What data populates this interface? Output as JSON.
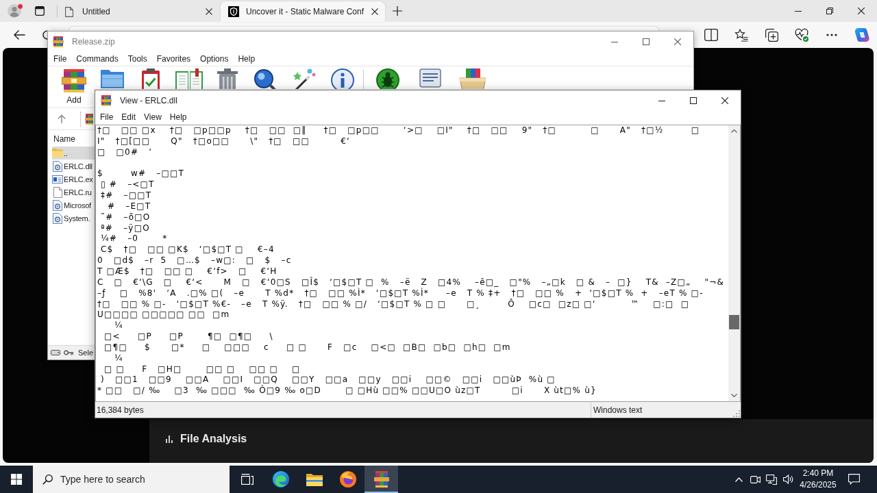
{
  "browser": {
    "tabs": [
      {
        "title": "Untitled",
        "kind": "document",
        "selected": false
      },
      {
        "title": "Uncover it - Static Malware Conf",
        "kind": "site",
        "selected": true
      }
    ]
  },
  "page": {
    "section_title": "File Analysis"
  },
  "archive_window": {
    "title": "Release.zip",
    "active": false,
    "menu": [
      "File",
      "Commands",
      "Tools",
      "Favorites",
      "Options",
      "Help"
    ],
    "toolbar_groups": [
      [
        {
          "kind": "add",
          "label": "Add"
        },
        {
          "kind": "extract"
        },
        {
          "kind": "test"
        },
        {
          "kind": "view"
        },
        {
          "kind": "delete"
        },
        {
          "kind": "find"
        },
        {
          "kind": "wizard"
        },
        {
          "kind": "info"
        }
      ],
      [
        {
          "kind": "virus_scan"
        },
        {
          "kind": "comment"
        },
        {
          "kind": "sfx"
        }
      ]
    ],
    "column": "Name",
    "files": [
      {
        "name": "..",
        "kind": "folder",
        "selected": true
      },
      {
        "name": "ERLC.dll",
        "kind": "library",
        "selected": false
      },
      {
        "name": "ERLC.ex",
        "kind": "program",
        "selected": false
      },
      {
        "name": "ERLC.ru",
        "kind": "file",
        "selected": false
      },
      {
        "name": "Microsof",
        "kind": "library",
        "selected": false
      },
      {
        "name": "System.",
        "kind": "library",
        "selected": false
      }
    ],
    "status": "Sele"
  },
  "viewer_window": {
    "title": "View - ERLC.dll",
    "active": true,
    "menu": [
      "File",
      "Edit",
      "View",
      "Help"
    ],
    "content": "†□   □□ □x    †□   □p□□p    †□   □□  □‖     †□   □p□□       ‘>□    □I\"    †□   □□    9\"   †□          □      A\"   †□½        □\nI\"   †□[□□      Q\"   †□o□□      \\\"   †□   □□         €‘\n□   □0#   ‘\n\n$        w#   –□□T\n ▯ #   –<□T\n ‡#   –□□T\n   #   –E□T\n ˜#   –õ□O\n ª#   –ÿ□O\n ¼#   –0       *\n C$   †□   □□ □K$   ‘□$□T □    €–4\n0   □d$   –r  5   □…$   –w□:   □   $   –c\nT □Æ$   †□   □□ □    €‘f>   □    €‘H\nC   □   €‘\\G   □    €‘<      M   □   €‘0□S   □Î$   ‘□$□T □  %   –ë   Z   □4%    –ê□_   □\"%   –„□k   □ &   –  □}    T&  –Z□„    \"¬&\n–ƒ    □   %8'   ‘A   .□% □(   –e      T %d*   †□   □□ %Ì*   ‘□$□T %Ì*     –e   T % ‡+   †□   □□ %   +  ‘□$□T %  +   –eT % □-\n†□   □□ % □-   ‘□$□T %€-   –e   T %ÿ.   †□   □□ % □/   ‘□$□T % □ □      □¸        Ô    □c□  □z□ □‘          ™    □:□  □\nU□□□□ □□□□□ □□  □m\n     ¼\n  □<     □P     □P       ¶□  □¶□     \\\n  □¶□     $      □*     □    □□□    c     □ □      F   □c    □<□  □B□  □b□  □h□  □m\n     ¼\n  □ □     F   □H□       □□ □    □□ □    □\n )   □□1   □□9    □□A    □□I   □□Q    □□Y   □□a   □□y   □□i    □□©   □□i   □□ùÞ  %ù □\n* □□   □/ ‰    □3  ‰ □□□  ‰ Ò□9 ‰ o□D       □ □Hù □□% □□U□O ùz□T         □i      X ùt□% ù}",
    "status": [
      "16,384 bytes",
      "Windows text"
    ]
  },
  "taskbar": {
    "search_placeholder": "Type here to search",
    "apps": [
      {
        "kind": "task_view",
        "selected": false
      },
      {
        "kind": "edge",
        "selected": false
      },
      {
        "kind": "explorer",
        "selected": false
      },
      {
        "kind": "firefox",
        "selected": false
      },
      {
        "kind": "winrar",
        "selected": true
      }
    ],
    "time": "2:40 PM",
    "date": "4/26/2025"
  }
}
